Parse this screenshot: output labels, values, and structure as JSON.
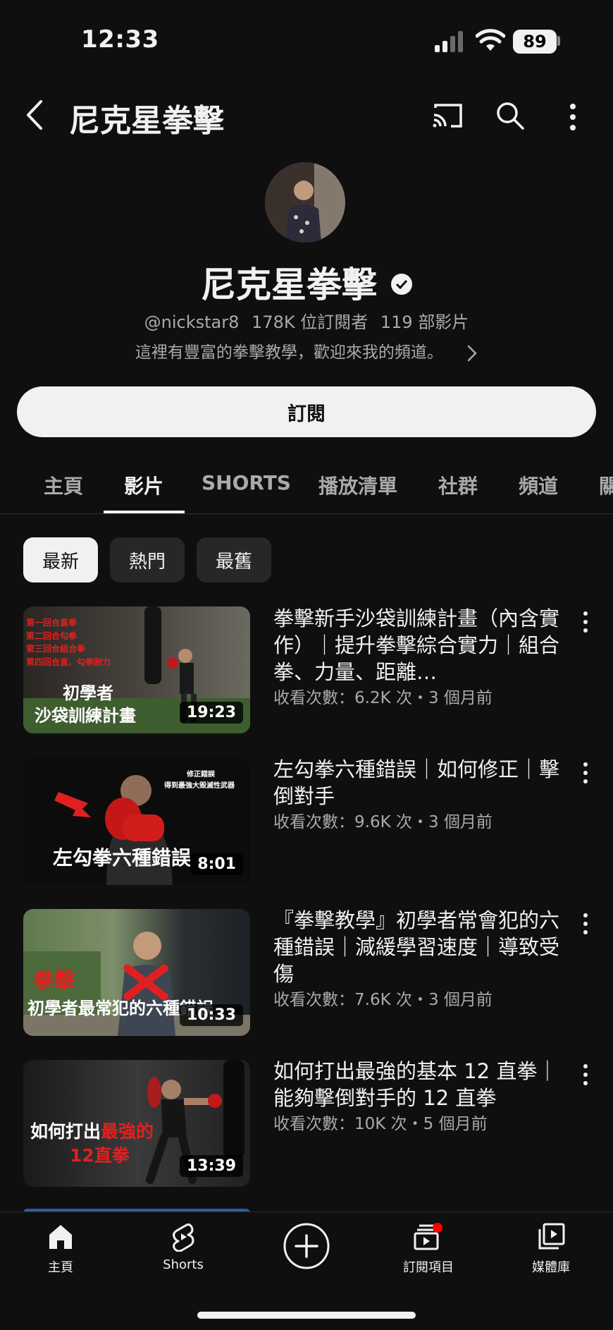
{
  "status_bar": {
    "time": "12:33",
    "battery": "89"
  },
  "header": {
    "title": "尼克星拳擊",
    "icons": [
      "back-icon",
      "cast-icon",
      "search-icon",
      "more-vert-icon"
    ]
  },
  "channel": {
    "name": "尼克星拳擊",
    "handle": "@nickstar8",
    "subscribers": "178K 位訂閱者",
    "video_count": "119 部影片",
    "description": "這裡有豐富的拳擊教學，歡迎來我的頻道。",
    "subscribe_label": "訂閱"
  },
  "tabs": [
    {
      "label": "主頁",
      "active": false
    },
    {
      "label": "影片",
      "active": true
    },
    {
      "label": "SHORTS",
      "active": false
    },
    {
      "label": "播放清單",
      "active": false
    },
    {
      "label": "社群",
      "active": false
    },
    {
      "label": "頻道",
      "active": false
    },
    {
      "label": "關",
      "active": false
    }
  ],
  "chips": [
    {
      "label": "最新",
      "active": true
    },
    {
      "label": "熱門",
      "active": false
    },
    {
      "label": "最舊",
      "active": false
    }
  ],
  "videos": [
    {
      "title": "拳擊新手沙袋訓練計畫（內含實作）｜提升拳擊綜合實力｜組合拳、力量、距離…",
      "meta": "收看次數：6.2K 次・3 個月前",
      "duration": "19:23",
      "thumb_text": {
        "list": [
          "第一回合直拳",
          "第二回合勾拳",
          "第三回合組合拳",
          "第四回合直、勾拳耐力"
        ],
        "line1": "初學者",
        "line2": "沙袋訓練計畫"
      }
    },
    {
      "title": "左勾拳六種錯誤｜如何修正｜擊倒對手",
      "meta": "收看次數：9.6K 次・3 個月前",
      "duration": "8:01",
      "thumb_text": {
        "small1": "修正錯誤",
        "small2": "得到最強大毀滅性武器",
        "main": "左勾拳六種錯誤"
      }
    },
    {
      "title": "『拳擊教學』初學者常會犯的六種錯誤｜減緩學習速度｜導致受傷",
      "meta": "收看次數：7.6K 次・3 個月前",
      "duration": "10:33",
      "thumb_text": {
        "red": "拳擊",
        "main": "初學者最常犯的六種錯誤"
      }
    },
    {
      "title": "如何打出最強的基本 12 直拳｜能夠擊倒對手的 12 直拳",
      "meta": "收看次數：10K 次・5 個月前",
      "duration": "13:39",
      "thumb_text": {
        "white": "如何打出",
        "red": "最強的",
        "line2": "12直拳"
      }
    }
  ],
  "bottom_nav": [
    {
      "label": "主頁",
      "icon": "home-icon"
    },
    {
      "label": "Shorts",
      "icon": "shorts-icon"
    },
    {
      "label": "",
      "icon": "create-icon"
    },
    {
      "label": "訂閱項目",
      "icon": "subscriptions-icon"
    },
    {
      "label": "媒體庫",
      "icon": "library-icon"
    }
  ],
  "colors": {
    "background": "#0f0f0f",
    "text": "#f1f1f1",
    "secondary": "#aaaaaa",
    "accent_red": "#ff0000"
  }
}
